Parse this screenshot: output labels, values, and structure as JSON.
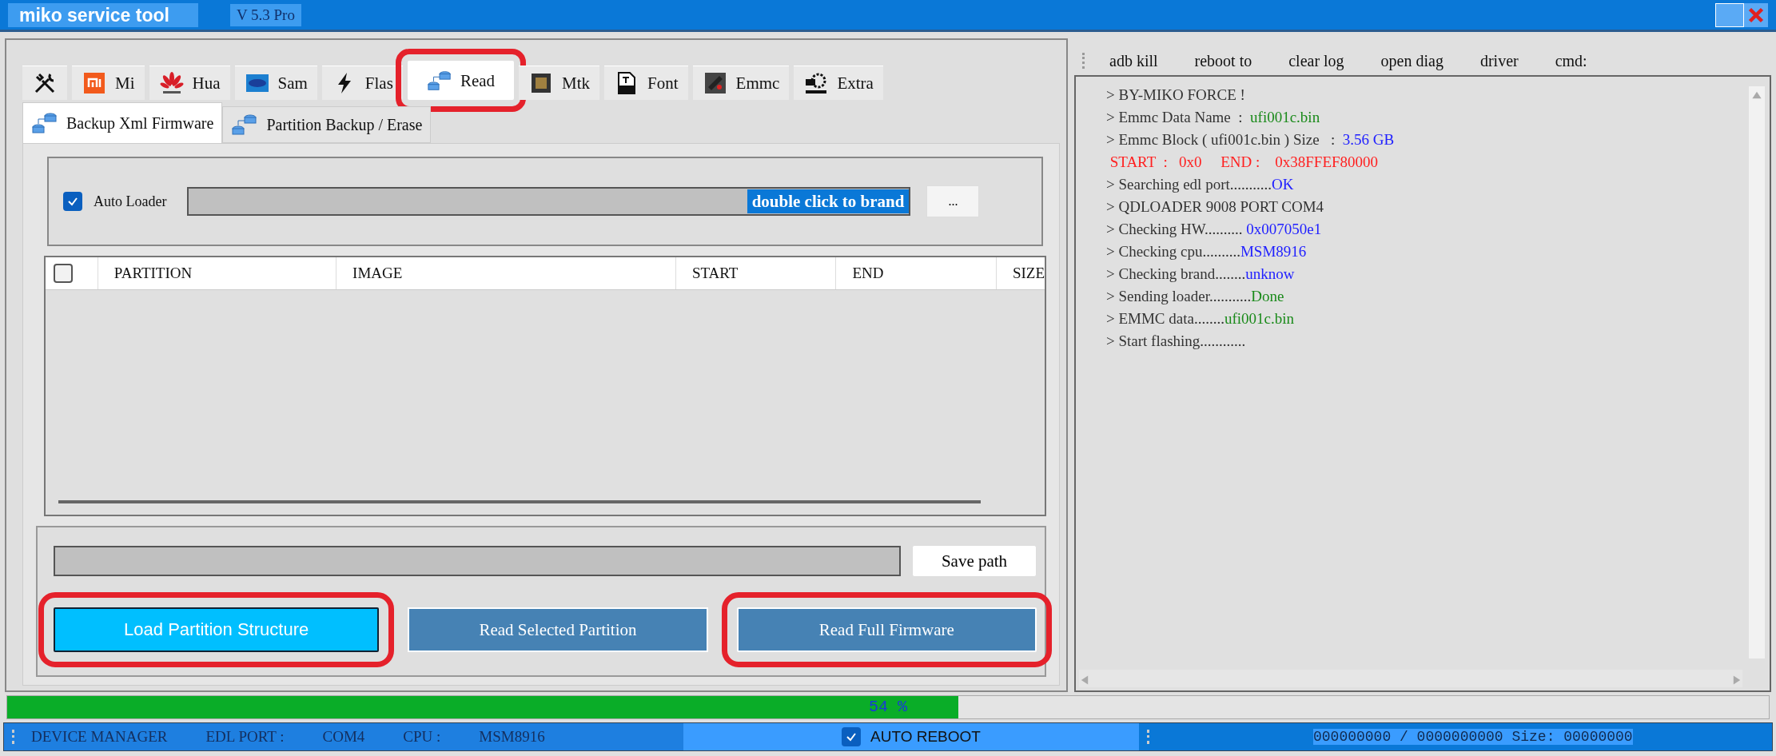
{
  "window": {
    "title": "miko service tool",
    "version": "V 5.3 Pro"
  },
  "tabs": [
    {
      "selected": false,
      "annotated": false
    },
    {
      "label": "Mi",
      "selected": false,
      "annotated": false
    },
    {
      "label": "Hua",
      "selected": false,
      "annotated": false
    },
    {
      "label": "Sam",
      "selected": false,
      "annotated": false
    },
    {
      "label": "Flas",
      "selected": false,
      "annotated": false
    },
    {
      "label": "Read",
      "selected": true,
      "annotated": true
    },
    {
      "label": "Mtk",
      "selected": false,
      "annotated": false
    },
    {
      "label": "Font",
      "selected": false,
      "annotated": false
    },
    {
      "label": "Emmc",
      "selected": false,
      "annotated": false
    },
    {
      "label": "Extra",
      "selected": false,
      "annotated": false
    }
  ],
  "subtabs": [
    {
      "label": "Backup Xml Firmware",
      "selected": true
    },
    {
      "label": "Partition Backup / Erase",
      "selected": false
    }
  ],
  "loader": {
    "label": "Auto Loader",
    "checked": true,
    "value": "double click to brand",
    "browse": "..."
  },
  "table": {
    "all_checked": false,
    "columns": [
      "PARTITION",
      "IMAGE",
      "START",
      "END",
      "SIZE"
    ]
  },
  "save_path": {
    "button": "Save path"
  },
  "actions": [
    {
      "label": "Load Partition Structure",
      "kind": "primary",
      "annotated": true
    },
    {
      "label": "Read Selected Partition",
      "kind": "secondary",
      "annotated": false
    },
    {
      "label": "Read Full Firmware",
      "kind": "secondary",
      "annotated": true
    }
  ],
  "toolbar": [
    "adb kill",
    "reboot to",
    "clear log",
    "open diag",
    "driver",
    "cmd:"
  ],
  "log": [
    {
      "parts": [
        {
          "text": "> BY-MIKO FORCE !",
          "color": "#333333"
        }
      ]
    },
    {
      "parts": [
        {
          "text": "> Emmc Data Name  :  ",
          "color": "#333333"
        },
        {
          "text": "ufi001c.bin",
          "color": "#1a8a1a"
        }
      ]
    },
    {
      "parts": [
        {
          "text": "> Emmc Block ( ufi001c.bin ) Size   :  ",
          "color": "#333333"
        },
        {
          "text": "3.56 GB",
          "color": "#2020ff"
        }
      ]
    },
    {
      "parts": [
        {
          "text": " START  :   0x0     END :    0x38FFEF80000",
          "color": "#ff2020"
        }
      ]
    },
    {
      "parts": [
        {
          "text": "> Searching edl port...........",
          "color": "#333333"
        },
        {
          "text": "OK",
          "color": "#2020ff"
        }
      ]
    },
    {
      "parts": [
        {
          "text": "> QDLOADER 9008 PORT COM4",
          "color": "#333333"
        }
      ]
    },
    {
      "parts": [
        {
          "text": "> Checking HW.......... ",
          "color": "#333333"
        },
        {
          "text": "0x007050e1",
          "color": "#2020ff"
        }
      ]
    },
    {
      "parts": [
        {
          "text": "> Checking cpu..........",
          "color": "#333333"
        },
        {
          "text": "MSM8916",
          "color": "#2020ff"
        }
      ]
    },
    {
      "parts": [
        {
          "text": "> Checking brand........",
          "color": "#333333"
        },
        {
          "text": "unknow",
          "color": "#2020ff"
        }
      ]
    },
    {
      "parts": [
        {
          "text": "> Sending loader...........",
          "color": "#333333"
        },
        {
          "text": "Done",
          "color": "#1a8a1a"
        }
      ]
    },
    {
      "parts": [
        {
          "text": "> EMMC data........",
          "color": "#333333"
        },
        {
          "text": "ufi001c.bin",
          "color": "#1a8a1a"
        }
      ]
    },
    {
      "parts": [
        {
          "text": "> Start flashing............",
          "color": "#333333"
        }
      ]
    }
  ],
  "progress": {
    "level": 0.54,
    "text": "54 %"
  },
  "status_bar": {
    "items": [
      "DEVICE MANAGER",
      "EDL PORT :",
      "COM4",
      "CPU :",
      "MSM8916"
    ],
    "auto_reboot": {
      "label": "AUTO REBOOT",
      "checked": true
    },
    "counter": "000000000 / 0000000000 Size: 00000000"
  }
}
